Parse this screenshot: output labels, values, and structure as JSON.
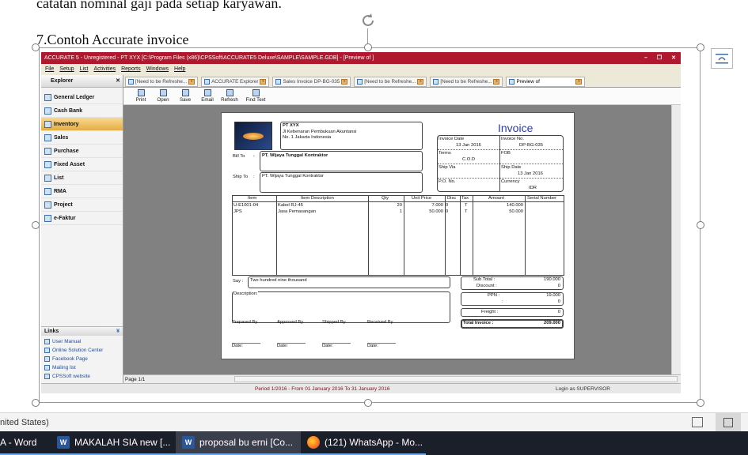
{
  "document": {
    "line1": "catatan nominal gaji pada setiap karyawan.",
    "heading": "7.Contoh Accurate invoice"
  },
  "accurate": {
    "title": "ACCURATE 5 - Unregistered - PT XYX  [C:\\Program Files (x86)\\CPSSoft\\ACCURATE5 Deluxe\\SAMPLE\\SAMPLE.GDB] - [Preview of ]",
    "menu": [
      "File",
      "Setup",
      "List",
      "Activities",
      "Reports",
      "Windows",
      "Help"
    ],
    "explorer": {
      "title": "Explorer",
      "items": [
        "General Ledger",
        "Cash Bank",
        "Inventory",
        "Sales",
        "Purchase",
        "Fixed Asset",
        "List",
        "RMA",
        "Project",
        "e-Faktur"
      ]
    },
    "links": {
      "title": "Links",
      "items": [
        "User Manual",
        "Online Solution Center",
        "Facebook Page",
        "Mailing list",
        "CPSSoft website"
      ]
    },
    "tabs": [
      "[Need to be Refreshe...",
      "ACCURATE Explorer",
      "Sales Invoice DP-BG-035",
      "[Need to be Refreshe...",
      "[Need to be Refreshe...",
      "Preview of"
    ],
    "toolbar": [
      "Print",
      "Open",
      "Save",
      "Email",
      "Refresh",
      "Find Text"
    ],
    "page_indicator": "Page 1/1",
    "period": "Period 1/2016 - From 01 January 2016 To 31 January 2016",
    "login": "Login as SUPERVISOR"
  },
  "invoice": {
    "company": {
      "name": "PT XYX",
      "address1": "Jl Kebenaran Pembukuan Akuntansi",
      "address2": "No. 1 Jakarta Indonesia"
    },
    "title": "Invoice",
    "info": {
      "date_label": "Invoice Date",
      "date_value": "13 Jan 2016",
      "no_label": "Invoice No.",
      "no_value": "DP-BG-035",
      "terms_label": "Terms",
      "terms_value": "C.O.D",
      "fob_label": "FOB",
      "ship_via_label": "Ship Via",
      "ship_date_label": "Ship Date",
      "ship_date_value": "13 Jan 2016",
      "po_label": "P.O. No.",
      "currency_label": "Currency",
      "currency_value": "IDR"
    },
    "bill_to_label": "Bill To",
    "bill_to_value": "PT. Wijaya Tunggal Kontraktor",
    "ship_to_label": "Ship To",
    "ship_to_value": "PT. Wijaya Tunggal Kontraktor",
    "columns": [
      "Item",
      "Item Description",
      "Qty",
      "Unit Price",
      "Disc",
      "Tax",
      "Amount",
      "Serial Number"
    ],
    "rows": [
      {
        "item": "U-E1001-04",
        "description": "Kabel RJ-45",
        "qty": "20",
        "unit_price": "7.000",
        "disc": "0",
        "tax": "T",
        "amount": "140.000"
      },
      {
        "item": "JPS",
        "description": "Jasa Pemasangan",
        "qty": "1",
        "unit_price": "50.000",
        "disc": "0",
        "tax": "T",
        "amount": "50.000"
      }
    ],
    "say_label": "Say :",
    "say_value": "Two hundred nine thousand",
    "description_label": "Description:",
    "totals": {
      "subtotal_label": "Sub Total :",
      "subtotal_value": "190.000",
      "discount_label": "Discount :",
      "discount_value": "0",
      "ppn_label": "PPN :",
      "ppn_value": "19.000",
      "other_value": "0",
      "freight_label": "Freight :",
      "freight_value": "0",
      "total_label": "Total Invoice :",
      "total_value": "209.000"
    },
    "signatures": [
      "Prepared By",
      "Approved By",
      "Shipped By",
      "Received By"
    ],
    "date_label": "Date:"
  },
  "word": {
    "language": "nited States)"
  },
  "taskbar": [
    "A - Word",
    "MAKALAH  SIA new [...",
    "proposal bu erni [Co...",
    "(121) WhatsApp - Mo..."
  ]
}
